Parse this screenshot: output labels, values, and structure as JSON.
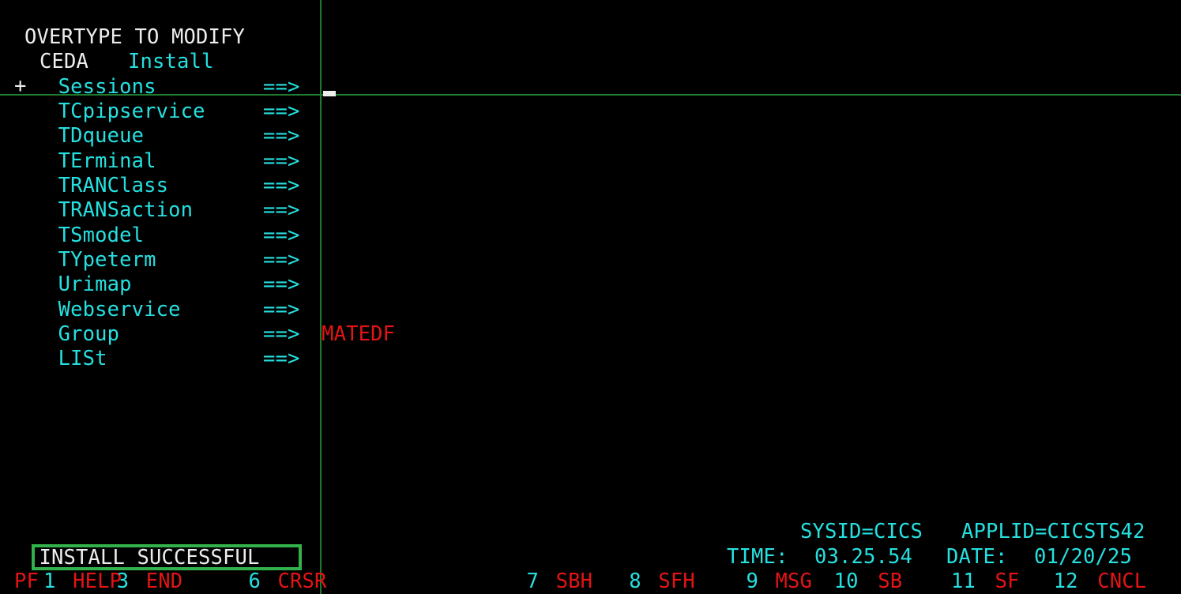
{
  "screen": {
    "type": "ibm-3270-terminal",
    "background_color": "#000000",
    "colors": {
      "cyan": "#26E0E0",
      "white": "#EDEDED",
      "red": "#E51414",
      "green": "#33B14A",
      "rule_green": "#1f7a2e"
    },
    "columns": 80,
    "rows": 24
  },
  "header": {
    "overtype_hint": "OVERTYPE TO MODIFY",
    "transaction": "CEDA",
    "command": "Install"
  },
  "scroll_indicator": "+",
  "fields": [
    {
      "label": "Sessions",
      "arrow": "==>",
      "value": ""
    },
    {
      "label": "TCpipservice",
      "arrow": "==>",
      "value": ""
    },
    {
      "label": "TDqueue",
      "arrow": "==>",
      "value": ""
    },
    {
      "label": "TErminal",
      "arrow": "==>",
      "value": ""
    },
    {
      "label": "TRANClass",
      "arrow": "==>",
      "value": ""
    },
    {
      "label": "TRANSaction",
      "arrow": "==>",
      "value": ""
    },
    {
      "label": "TSmodel",
      "arrow": "==>",
      "value": ""
    },
    {
      "label": "TYpeterm",
      "arrow": "==>",
      "value": ""
    },
    {
      "label": "Urimap",
      "arrow": "==>",
      "value": ""
    },
    {
      "label": "Webservice",
      "arrow": "==>",
      "value": ""
    },
    {
      "label": "Group",
      "arrow": "==>",
      "value": "MATEDF"
    },
    {
      "label": "LISt",
      "arrow": "==>",
      "value": ""
    }
  ],
  "status": {
    "message": "INSTALL SUCCESSFUL",
    "sysid_label": "SYSID=CICS",
    "applid_label": "APPLID=CICSTS42",
    "time_label": "TIME:",
    "time_value": "03.25.54",
    "date_label": "DATE:",
    "date_value": "01/20/25"
  },
  "pfkeys": {
    "prefix": "PF",
    "keys": [
      {
        "num": "1",
        "label": "HELP"
      },
      {
        "num": "3",
        "label": "END"
      },
      {
        "num": "6",
        "label": "CRSR"
      },
      {
        "num": "7",
        "label": "SBH"
      },
      {
        "num": "8",
        "label": "SFH"
      },
      {
        "num": "9",
        "label": "MSG"
      },
      {
        "num": "10",
        "label": "SB"
      },
      {
        "num": "11",
        "label": "SF"
      },
      {
        "num": "12",
        "label": "CNCL"
      }
    ]
  },
  "cursor": {
    "row": 3,
    "column": 21,
    "glyph": "_"
  }
}
